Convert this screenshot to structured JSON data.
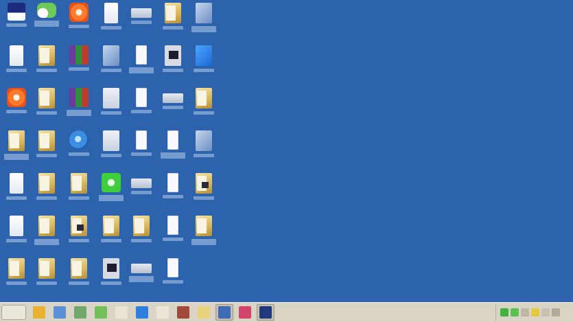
{
  "desktop": {
    "background": "#2d63ad",
    "icons": [
      {
        "kind": "pc"
      },
      {
        "kind": "net"
      },
      {
        "kind": "orange"
      },
      {
        "kind": "doc"
      },
      {
        "kind": "tray"
      },
      {
        "kind": "folder"
      },
      {
        "kind": "app"
      },
      {
        "kind": "doc"
      },
      {
        "kind": "folder"
      },
      {
        "kind": "rar"
      },
      {
        "kind": "app"
      },
      {
        "kind": "white"
      },
      {
        "kind": "dark"
      },
      {
        "kind": "blue"
      },
      {
        "kind": "orange"
      },
      {
        "kind": "folder"
      },
      {
        "kind": "rar"
      },
      {
        "kind": "pages"
      },
      {
        "kind": "white"
      },
      {
        "kind": "tray"
      },
      {
        "kind": "folder"
      },
      {
        "kind": "folder"
      },
      {
        "kind": "folder"
      },
      {
        "kind": "globe"
      },
      {
        "kind": "pages"
      },
      {
        "kind": "white"
      },
      {
        "kind": "white"
      },
      {
        "kind": "app"
      },
      {
        "kind": "doc"
      },
      {
        "kind": "folder"
      },
      {
        "kind": "folder"
      },
      {
        "kind": "green"
      },
      {
        "kind": "tray"
      },
      {
        "kind": "white"
      },
      {
        "kind": "folder-dark"
      },
      {
        "kind": "doc"
      },
      {
        "kind": "folder"
      },
      {
        "kind": "folder-dark"
      },
      {
        "kind": "folder"
      },
      {
        "kind": "folder"
      },
      {
        "kind": "white"
      },
      {
        "kind": "folder"
      },
      {
        "kind": "folder"
      },
      {
        "kind": "folder"
      },
      {
        "kind": "folder"
      },
      {
        "kind": "dark"
      },
      {
        "kind": "tray"
      },
      {
        "kind": "white"
      }
    ]
  },
  "taskbar": {
    "start_label": "",
    "quicklaunch": [
      {
        "icon": "windows-flag-icon",
        "color": "#e9b230"
      },
      {
        "icon": "folder-icon",
        "color": "#5b8fd6"
      },
      {
        "icon": "network-icon",
        "color": "#6fa86a"
      },
      {
        "icon": "app-green-icon",
        "color": "#73c05a"
      },
      {
        "icon": "document-icon",
        "color": "#e9e3d2"
      },
      {
        "icon": "app-blue-icon",
        "color": "#2f7fe0"
      },
      {
        "icon": "document-icon",
        "color": "#ece6d6"
      },
      {
        "icon": "rar-icon",
        "color": "#a24a3a"
      },
      {
        "icon": "folder-icon",
        "color": "#e8d27c"
      },
      {
        "icon": "monitor-icon",
        "color": "#3f6ab5",
        "active": true
      },
      {
        "icon": "media-icon",
        "color": "#d2456a"
      },
      {
        "icon": "app-navy-icon",
        "color": "#1f3a7a",
        "active": true
      }
    ],
    "tray_icons": [
      {
        "icon": "green-tray-icon",
        "color": "#3fb53c"
      },
      {
        "icon": "green-tray-icon",
        "color": "#59c34f"
      },
      {
        "icon": "gray-tray-icon",
        "color": "#bdb7a8"
      },
      {
        "icon": "yellow-tray-icon",
        "color": "#e6c93d"
      },
      {
        "icon": "gray-tray-icon",
        "color": "#c8c2b3"
      },
      {
        "icon": "gray-tray-icon",
        "color": "#b0aa9b"
      }
    ],
    "clock": ""
  }
}
